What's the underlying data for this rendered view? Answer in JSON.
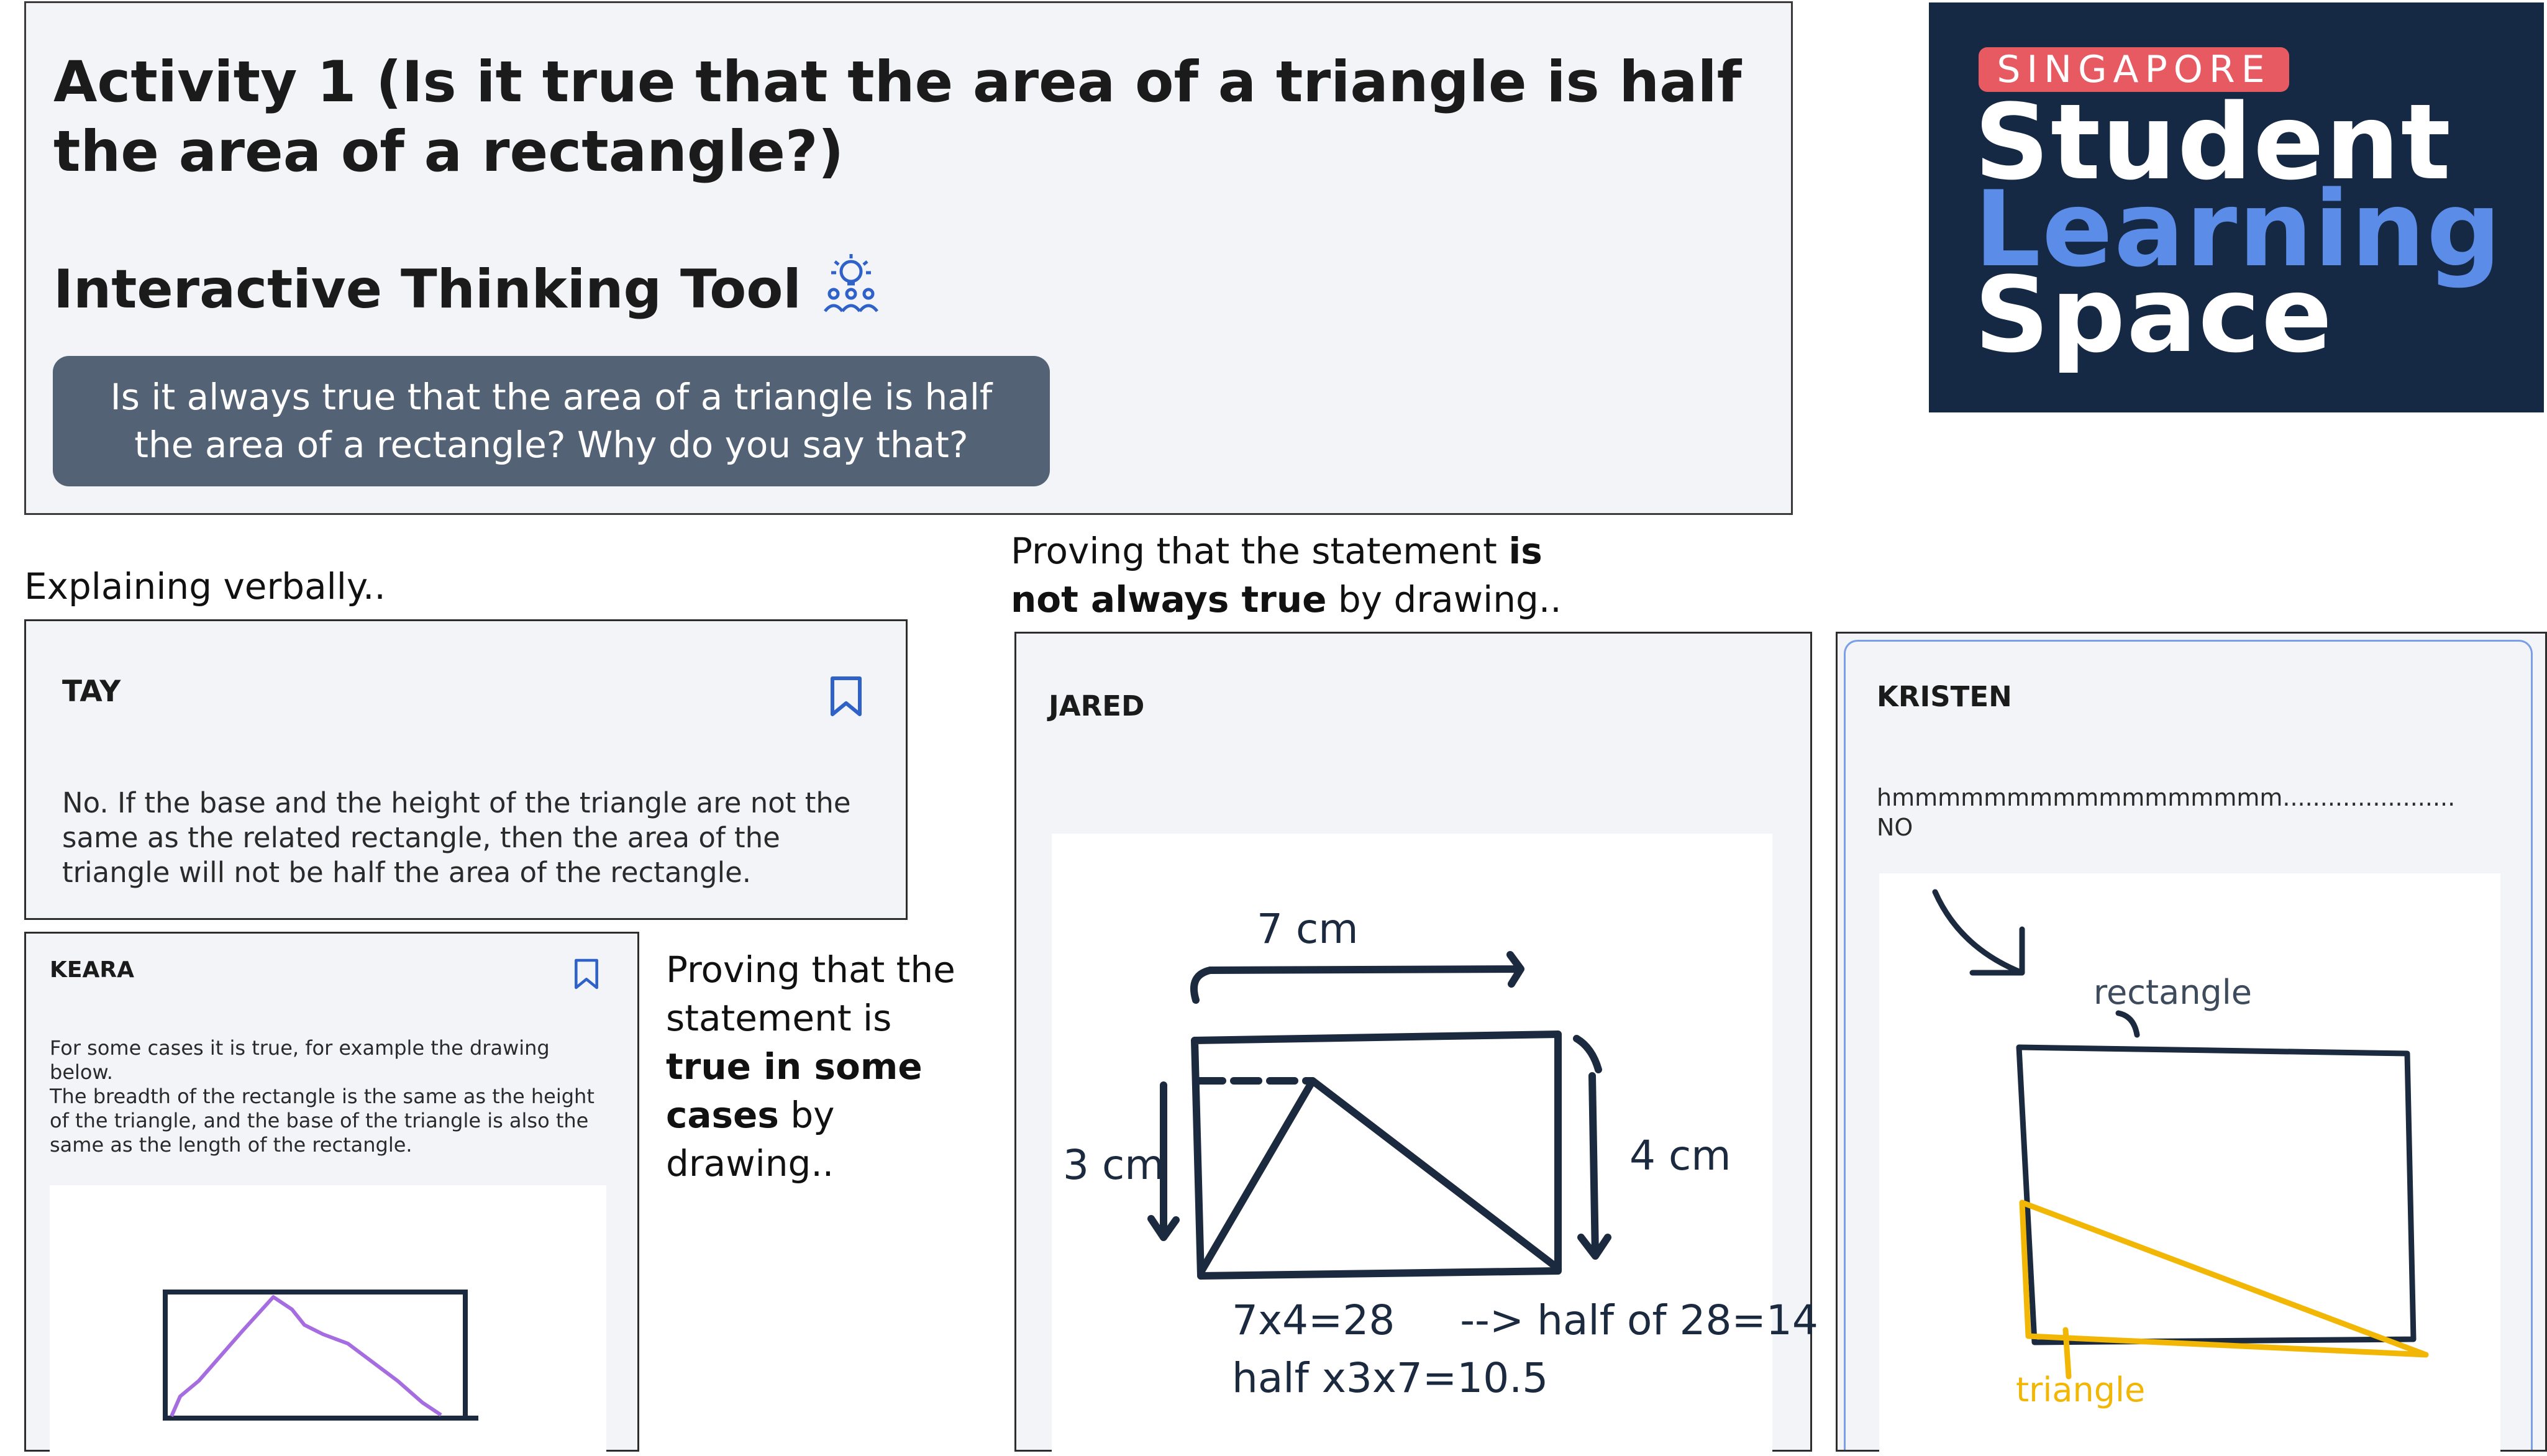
{
  "activity": {
    "title": "Activity 1 (Is it true that the area of a triangle is half the area of a rectangle?)",
    "tool_heading": "Interactive Thinking Tool",
    "tool_icon": "lightbulb-people-icon",
    "prompt": "Is it always true that the area of a triangle is half the area of a rectangle?  Why do you say that?"
  },
  "logo": {
    "country": "SINGAPORE",
    "line1": "Student",
    "line2": "Learning",
    "line3": "Space"
  },
  "captions": {
    "verbal": "Explaining verbally..",
    "not_true_pre": "Proving that the statement ",
    "not_true_bold": "is not always true",
    "not_true_post": " by drawing..",
    "true_pre": "Proving that the statement is ",
    "true_bold": "true in some cases",
    "true_post": " by drawing.."
  },
  "cards": {
    "tay": {
      "name": "TAY",
      "text": "No. If the base and the height of the triangle are not the same as the related rectangle, then the area of the triangle will not be half the area of the rectangle."
    },
    "keara": {
      "name": "KEARA",
      "text_1": "For some cases it is true, for example the drawing below.",
      "text_2": "The breadth of the rectangle is the same as the height of the triangle, and the base of the triangle is also the same as the length of the rectangle."
    },
    "jared": {
      "name": "JARED",
      "label_top": "7 cm",
      "label_left": "3 cm",
      "label_right": "4 cm",
      "calc_1": "7x4=28     --> half of 28=14",
      "calc_2": "half x3x7=10.5"
    },
    "kristen": {
      "name": "KRISTEN",
      "text_1": "hmmmmmmmmmmmmmmmmm.......................",
      "text_2": "NO",
      "label_rectangle": "rectangle",
      "label_triangle": "triangle"
    }
  },
  "colors": {
    "panel_bg": "#f3f4f8",
    "prompt_bg": "#536274",
    "logo_bg": "#152844",
    "logo_accent": "#5b8de8",
    "logo_pill": "#e85a62",
    "bookmark": "#2f62c9",
    "ink": "#1b2a3e",
    "purple": "#a56de0",
    "yellow": "#f2b705"
  }
}
